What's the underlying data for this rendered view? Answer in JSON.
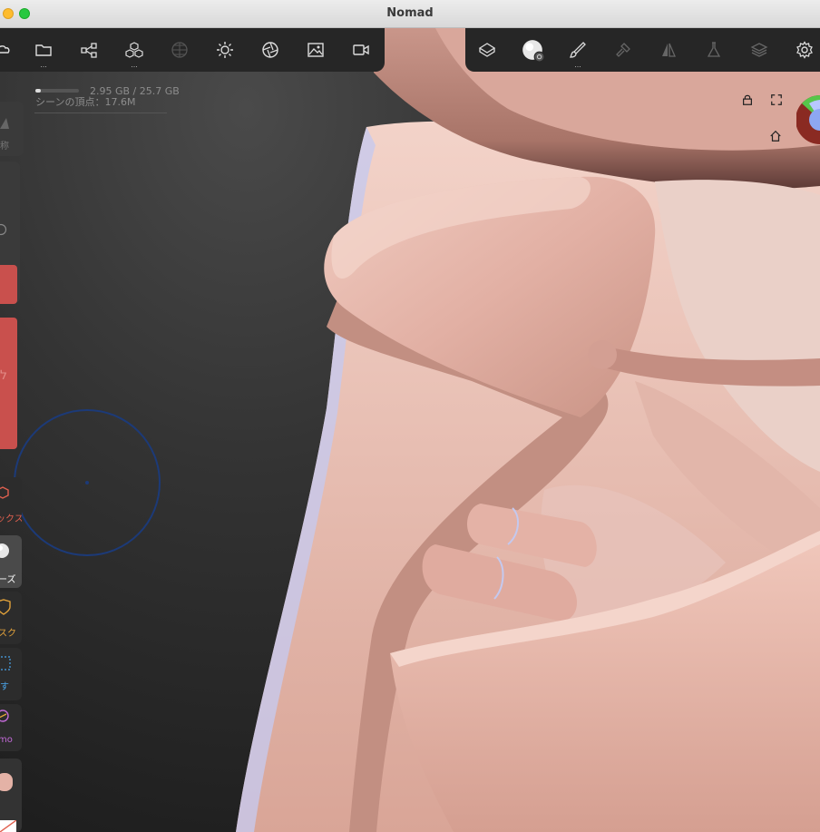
{
  "window": {
    "title": "Nomad"
  },
  "toolbar_left": {
    "items": [
      {
        "name": "cloud-icon"
      },
      {
        "name": "folder-icon",
        "more": "..."
      },
      {
        "name": "scene-graph-icon"
      },
      {
        "name": "primitives-icon",
        "more": "..."
      },
      {
        "name": "grid-sphere-icon"
      },
      {
        "name": "light-sun-icon"
      },
      {
        "name": "aperture-icon"
      },
      {
        "name": "image-icon"
      },
      {
        "name": "video-camera-icon"
      }
    ]
  },
  "toolbar_right": {
    "items": [
      {
        "name": "mesh-cube-icon"
      },
      {
        "name": "clay-material-icon"
      },
      {
        "name": "paint-brush-icon",
        "more": "..."
      },
      {
        "name": "hammer-icon"
      },
      {
        "name": "symmetry-icon"
      },
      {
        "name": "flask-icon"
      },
      {
        "name": "layers-icon"
      },
      {
        "name": "settings-gear-icon"
      }
    ]
  },
  "memory": {
    "usage": "2.95 GB / 25.7 GB",
    "vertices": "シーンの頂点：17.6M",
    "fill_fraction": 0.115
  },
  "side_tools": [
    {
      "label": "ックス",
      "color": "#e0604f"
    },
    {
      "label": "ーズ",
      "color": "#ffffff"
    },
    {
      "label": "スク",
      "color": "#e2a23b"
    },
    {
      "label": "す",
      "color": "#4aa3e8"
    },
    {
      "label": "mo",
      "color": "#c36ad8"
    }
  ],
  "side_label_top": "称",
  "colors": {
    "accent_red": "#c9504d",
    "brush_circle": "#1c3a78",
    "skin": "#e7b9ad"
  }
}
